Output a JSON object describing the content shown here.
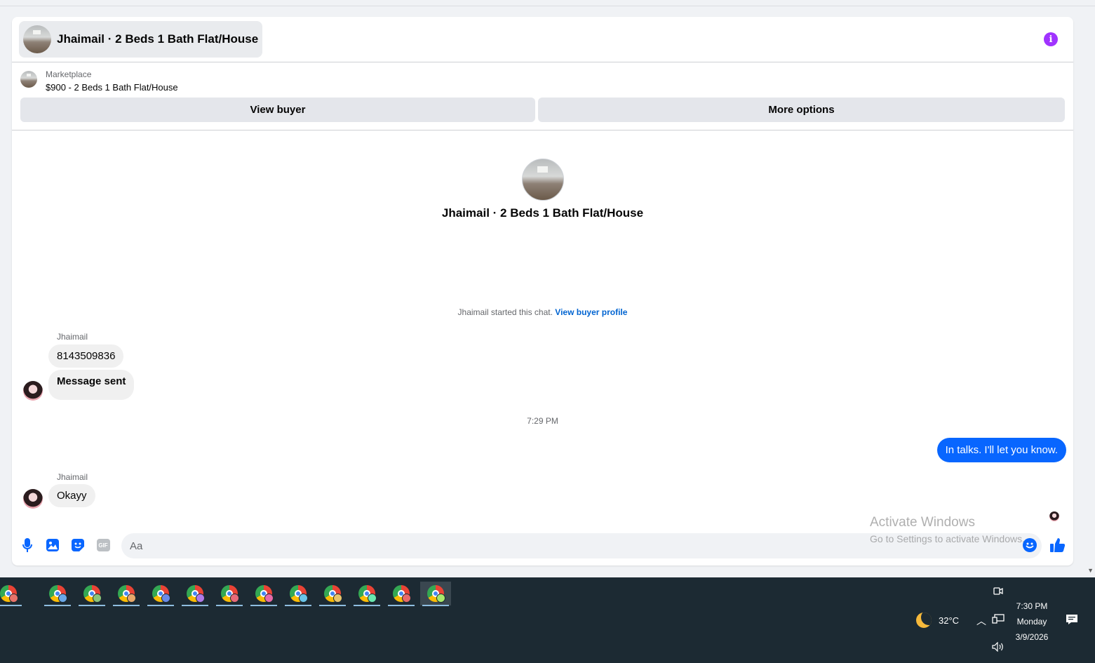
{
  "header": {
    "title": "Jhaimail · 2 Beds 1 Bath Flat/House",
    "info_icon": "info-icon",
    "info_glyph": "i"
  },
  "marketplace": {
    "label": "Marketplace",
    "listing": "$900 - 2 Beds 1 Bath Flat/House",
    "view_buyer_label": "View buyer",
    "more_options_label": "More options"
  },
  "conversation": {
    "title": "Jhaimail · 2 Beds 1 Bath Flat/House",
    "started_text": "Jhaimail started this chat.",
    "started_link": "View buyer profile",
    "groups": [
      {
        "sender": "Jhaimail",
        "messages": [
          "8143509836",
          "Message sent"
        ]
      }
    ],
    "timestamp": "7:29 PM",
    "outgoing_message": "In talks. I'll let you know.",
    "group2": {
      "sender": "Jhaimail",
      "message": "Okayy"
    }
  },
  "composer": {
    "placeholder": "Aa",
    "icons": [
      "microphone-icon",
      "photo-icon",
      "sticker-icon",
      "gif-icon",
      "emoji-icon",
      "thumbs-up-icon"
    ],
    "gif_label": "GIF"
  },
  "watermark": {
    "line1": "Activate Windows",
    "line2": "Go to Settings to activate Windows."
  },
  "taskbar": {
    "apps": [
      {
        "name": "chrome-profile-1",
        "badge": "#e8736a"
      },
      {
        "name": "chrome-profile-2",
        "badge": "#6aa8e8"
      },
      {
        "name": "chrome-profile-3",
        "badge": "#8bc47a"
      },
      {
        "name": "chrome-profile-4",
        "badge": "#e8a86a"
      },
      {
        "name": "chrome-profile-5",
        "badge": "#6a8be8"
      },
      {
        "name": "chrome-profile-6",
        "badge": "#b07ae8"
      },
      {
        "name": "chrome-profile-7",
        "badge": "#e86a7a"
      },
      {
        "name": "chrome-profile-8",
        "badge": "#e86aa8"
      },
      {
        "name": "chrome-profile-9",
        "badge": "#6ac4e8"
      },
      {
        "name": "chrome-profile-10",
        "badge": "#e8c46a"
      },
      {
        "name": "chrome-profile-11",
        "badge": "#6ae8b0"
      },
      {
        "name": "chrome-profile-12",
        "badge": "#e86a6a"
      },
      {
        "name": "chrome-profile-13",
        "badge": "#a8e86a"
      }
    ],
    "weather": "32°C",
    "time": "7:30 PM",
    "day": "Monday",
    "date": "3/9/2026"
  },
  "colors": {
    "accent": "#0866ff",
    "link": "#0064d1",
    "info": "#a033ff",
    "taskbar": "#1c2a33"
  }
}
